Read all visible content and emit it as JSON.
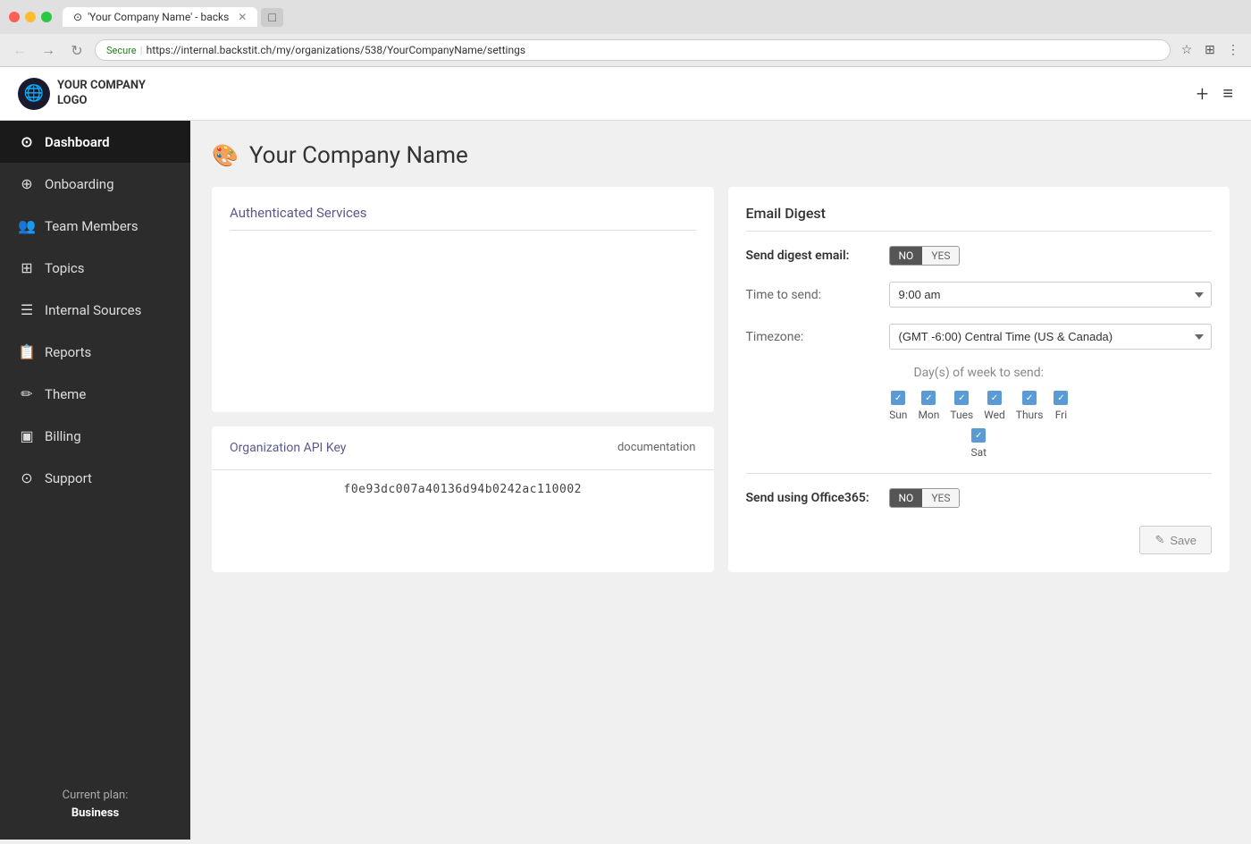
{
  "browser": {
    "tab_title": "'Your Company Name' - backs",
    "url_secure": "Secure",
    "url": "https://internal.backstit.ch/my/organizations/538/YourCompanyName/settings",
    "back_icon": "←",
    "forward_icon": "→",
    "refresh_icon": "↻"
  },
  "app_header": {
    "logo_text_line1": "YOUR COMPANY",
    "logo_text_line2": "LOGO",
    "plus_label": "+",
    "menu_label": "≡"
  },
  "sidebar": {
    "items": [
      {
        "label": "Dashboard",
        "icon": "⊙",
        "active": true
      },
      {
        "label": "Onboarding",
        "icon": "⊕"
      },
      {
        "label": "Team Members",
        "icon": "👥"
      },
      {
        "label": "Topics",
        "icon": "⊞"
      },
      {
        "label": "Internal Sources",
        "icon": "☰"
      },
      {
        "label": "Reports",
        "icon": "⬚"
      },
      {
        "label": "Theme",
        "icon": "✏"
      },
      {
        "label": "Billing",
        "icon": "▣"
      },
      {
        "label": "Support",
        "icon": "⊙"
      }
    ],
    "current_plan_label": "Current plan:",
    "current_plan_value": "Business"
  },
  "page": {
    "title": "Your Company Name",
    "title_icon": "🎨"
  },
  "authenticated_services": {
    "title": "Authenticated Services"
  },
  "api_key": {
    "label": "Organization API Key",
    "doc_link": "documentation",
    "value": "f0e93dc007a40136d94b0242ac110002"
  },
  "email_digest": {
    "section_title": "Email Digest",
    "send_digest_label": "Send digest email:",
    "send_digest_no": "NO",
    "send_digest_yes": "YES",
    "time_to_send_label": "Time to send:",
    "time_to_send_value": "9:00 am",
    "timezone_label": "Timezone:",
    "timezone_value": "(GMT -6:00) Central Time (US & Canada)",
    "days_label": "Day(s) of week to send:",
    "days": [
      {
        "label": "Sun",
        "checked": true
      },
      {
        "label": "Mon",
        "checked": true
      },
      {
        "label": "Tues",
        "checked": true
      },
      {
        "label": "Wed",
        "checked": true
      },
      {
        "label": "Thurs",
        "checked": true
      },
      {
        "label": "Fri",
        "checked": true
      }
    ],
    "days_row2": [
      {
        "label": "Sat",
        "checked": true
      }
    ],
    "send_office365_label": "Send using Office365:",
    "send_office365_no": "NO",
    "send_office365_yes": "YES",
    "save_label": "Save",
    "save_icon": "✎"
  }
}
